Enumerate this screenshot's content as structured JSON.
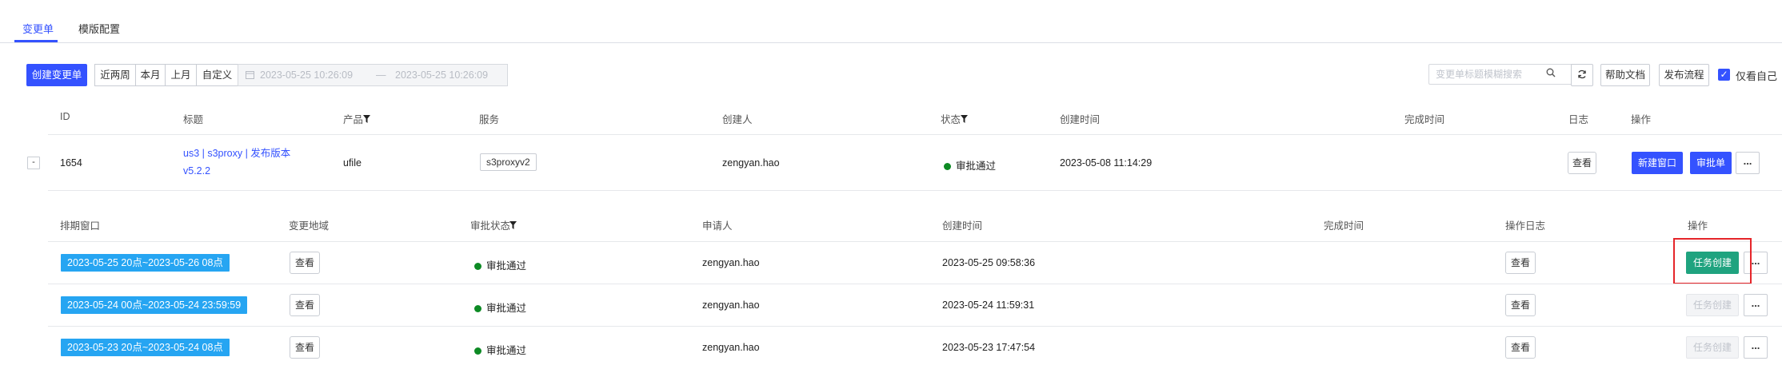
{
  "tabs": [
    {
      "label": "变更单",
      "active": true
    },
    {
      "label": "模版配置",
      "active": false
    }
  ],
  "toolbar": {
    "create_label": "创建变更单",
    "ranges": [
      "近两周",
      "本月",
      "上月",
      "自定义"
    ],
    "date_start": "2023-05-25 10:26:09",
    "date_sep": "—",
    "date_end": "2023-05-25 10:26:09",
    "search_placeholder": "变更单标题模糊搜索",
    "help_label": "帮助文档",
    "flow_label": "发布流程",
    "only_mine_label": "仅看自己",
    "only_mine_checked": true
  },
  "main_table": {
    "headers": {
      "id": "ID",
      "title": "标题",
      "product": "产品",
      "service": "服务",
      "creator": "创建人",
      "status": "状态",
      "created": "创建时间",
      "finished": "完成时间",
      "log": "日志",
      "actions": "操作"
    },
    "row": {
      "expand": "-",
      "id": "1654",
      "title_line1": "us3 | s3proxy | 发布版本",
      "title_line2": "v5.2.2",
      "product": "ufile",
      "service": "s3proxyv2",
      "creator": "zengyan.hao",
      "status": "审批通过",
      "created": "2023-05-08 11:14:29",
      "finished": "",
      "view_label": "查看",
      "new_window_label": "新建窗口",
      "approval_label": "审批单",
      "more_label": "..."
    }
  },
  "sub_table": {
    "headers": {
      "window": "排期窗口",
      "region": "变更地域",
      "approval": "审批状态",
      "applicant": "申请人",
      "created": "创建时间",
      "finished": "完成时间",
      "oplog": "操作日志",
      "actions": "操作"
    },
    "rows": [
      {
        "window": "2023-05-25 20点~2023-05-26 08点",
        "region_btn": "查看",
        "approval": "审批通过",
        "applicant": "zengyan.hao",
        "created": "2023-05-25 09:58:36",
        "finished": "",
        "log_btn": "查看",
        "task_btn": "任务创建",
        "task_enabled": true,
        "more": "..."
      },
      {
        "window": "2023-05-24 00点~2023-05-24 23:59:59",
        "region_btn": "查看",
        "approval": "审批通过",
        "applicant": "zengyan.hao",
        "created": "2023-05-24 11:59:31",
        "finished": "",
        "log_btn": "查看",
        "task_btn": "任务创建",
        "task_enabled": false,
        "more": "..."
      },
      {
        "window": "2023-05-23 20点~2023-05-24 08点",
        "region_btn": "查看",
        "approval": "审批通过",
        "applicant": "zengyan.hao",
        "created": "2023-05-23 17:47:54",
        "finished": "",
        "log_btn": "查看",
        "task_btn": "任务创建",
        "task_enabled": false,
        "more": "..."
      }
    ]
  },
  "colors": {
    "primary": "#3452ff",
    "success_dot": "#0d8a24",
    "window_tag": "#26a5f2",
    "task_enabled": "#1fa37f",
    "highlight_box": "#e5252a"
  }
}
